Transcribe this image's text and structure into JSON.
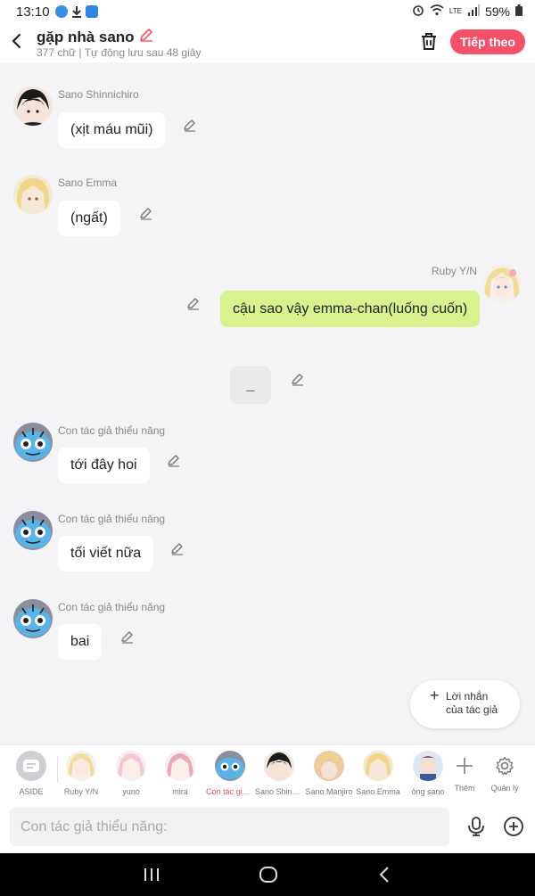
{
  "status_bar": {
    "time": "13:10",
    "battery": "59%"
  },
  "header": {
    "title": "gặp nhà sano",
    "subtitle": "377 chữ | Tự động lưu sau 48 giây",
    "next_label": "Tiếp theo"
  },
  "messages": [
    {
      "sender": "Sano Shinnichiro",
      "text": "(xịt máu mũi)"
    },
    {
      "sender": "Sano Emma",
      "text": "(ngất)"
    },
    {
      "sender": "Ruby Y/N",
      "text": "cậu sao vậy emma-chan(luống cuốn)"
    },
    {
      "sender": "",
      "text": "_"
    },
    {
      "sender": "Con tác giả thiểu năng",
      "text": "tới đây hoi"
    },
    {
      "sender": "Con tác giả thiểu năng",
      "text": "tối viết nữa"
    },
    {
      "sender": "Con tác giả thiểu năng",
      "text": "bai"
    }
  ],
  "note_button": {
    "line1": "Lời nhắn",
    "line2": "của tác giả"
  },
  "characters": [
    {
      "label": "ASIDE"
    },
    {
      "label": "Ruby Y/N"
    },
    {
      "label": "yuno"
    },
    {
      "label": "mira"
    },
    {
      "label": "Con tác giả thiểu năng",
      "active": true
    },
    {
      "label": "Sano Shinnichiro"
    },
    {
      "label": "Sano Manjiro"
    },
    {
      "label": "Sano Emma"
    },
    {
      "label": "ông sano"
    },
    {
      "label": "Thêm"
    },
    {
      "label": "Quản lý"
    }
  ],
  "input": {
    "placeholder": "Con tác giả thiểu năng:"
  },
  "colors": {
    "accent": "#f5506a",
    "my_bubble": "#d7f28f",
    "background": "#f4f4f6"
  }
}
